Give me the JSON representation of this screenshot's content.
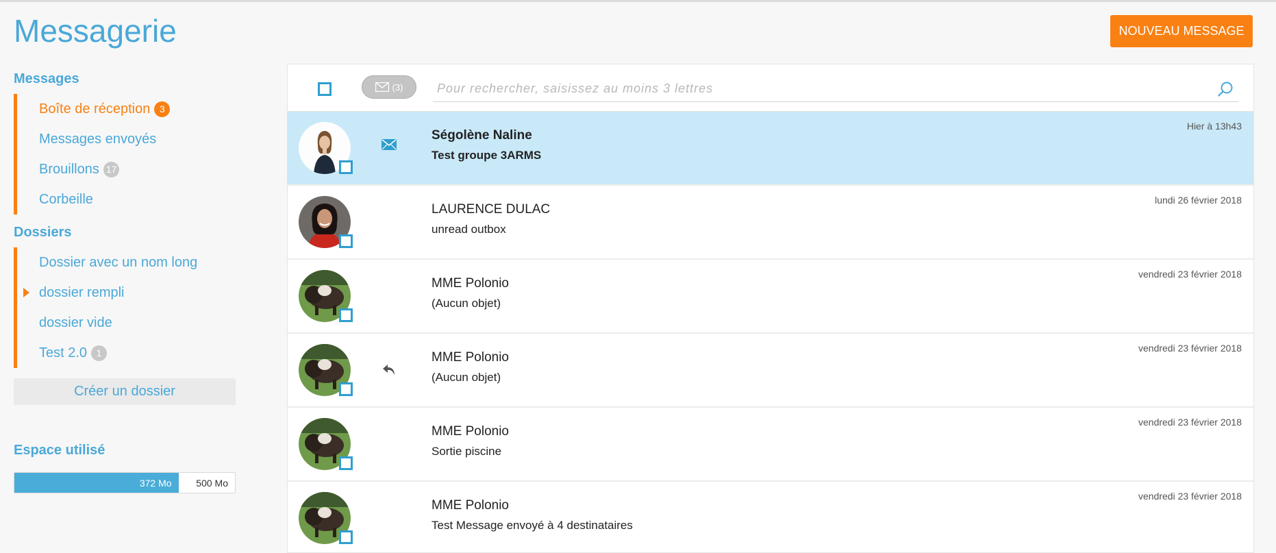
{
  "title": "Messagerie",
  "new_message_label": "NOUVEAU MESSAGE",
  "sidebar": {
    "messages_title": "Messages",
    "mail_items": [
      {
        "label": "Boîte de réception",
        "badge": "3",
        "active": true
      },
      {
        "label": "Messages envoyés",
        "badge": null
      },
      {
        "label": "Brouillons",
        "badge": "17"
      },
      {
        "label": "Corbeille",
        "badge": null
      }
    ],
    "folders_title": "Dossiers",
    "folders": [
      {
        "label": "Dossier avec un nom long",
        "badge": null,
        "expandable": false
      },
      {
        "label": "dossier rempli",
        "badge": null,
        "expandable": true
      },
      {
        "label": "dossier vide",
        "badge": null,
        "expandable": false
      },
      {
        "label": "Test 2.0",
        "badge": "1",
        "expandable": false
      }
    ],
    "create_folder_label": "Créer un dossier",
    "storage_title": "Espace utilisé",
    "storage_used": "372 Mo",
    "storage_total": "500 Mo",
    "storage_fraction": 0.744
  },
  "toolbar": {
    "unread_count": "(3)",
    "search_placeholder": "Pour rechercher, saisissez au moins 3 lettres"
  },
  "messages": [
    {
      "sender": "Ségolène Naline",
      "subject": "Test groupe 3ARMS",
      "date": "Hier à 13h43",
      "status": "unread",
      "avatar": "woman-1",
      "selected": true
    },
    {
      "sender": "LAURENCE DULAC",
      "subject": "unread outbox",
      "date": "lundi 26 février 2018",
      "status": "none",
      "avatar": "woman-2",
      "selected": false
    },
    {
      "sender": "MME Polonio",
      "subject": "(Aucun objet)",
      "date": "vendredi 23 février 2018",
      "status": "none",
      "avatar": "bison",
      "selected": false
    },
    {
      "sender": "MME Polonio",
      "subject": "(Aucun objet)",
      "date": "vendredi 23 février 2018",
      "status": "replied",
      "avatar": "bison",
      "selected": false
    },
    {
      "sender": "MME Polonio",
      "subject": "Sortie piscine",
      "date": "vendredi 23 février 2018",
      "status": "none",
      "avatar": "bison",
      "selected": false
    },
    {
      "sender": "MME Polonio",
      "subject": "Test Message envoyé à 4 destinataires",
      "date": "vendredi 23 février 2018",
      "status": "none",
      "avatar": "bison",
      "selected": false
    }
  ],
  "colors": {
    "accent_blue": "#4aa8d8",
    "accent_orange": "#f98012",
    "selected_row": "#c9e9f8"
  }
}
